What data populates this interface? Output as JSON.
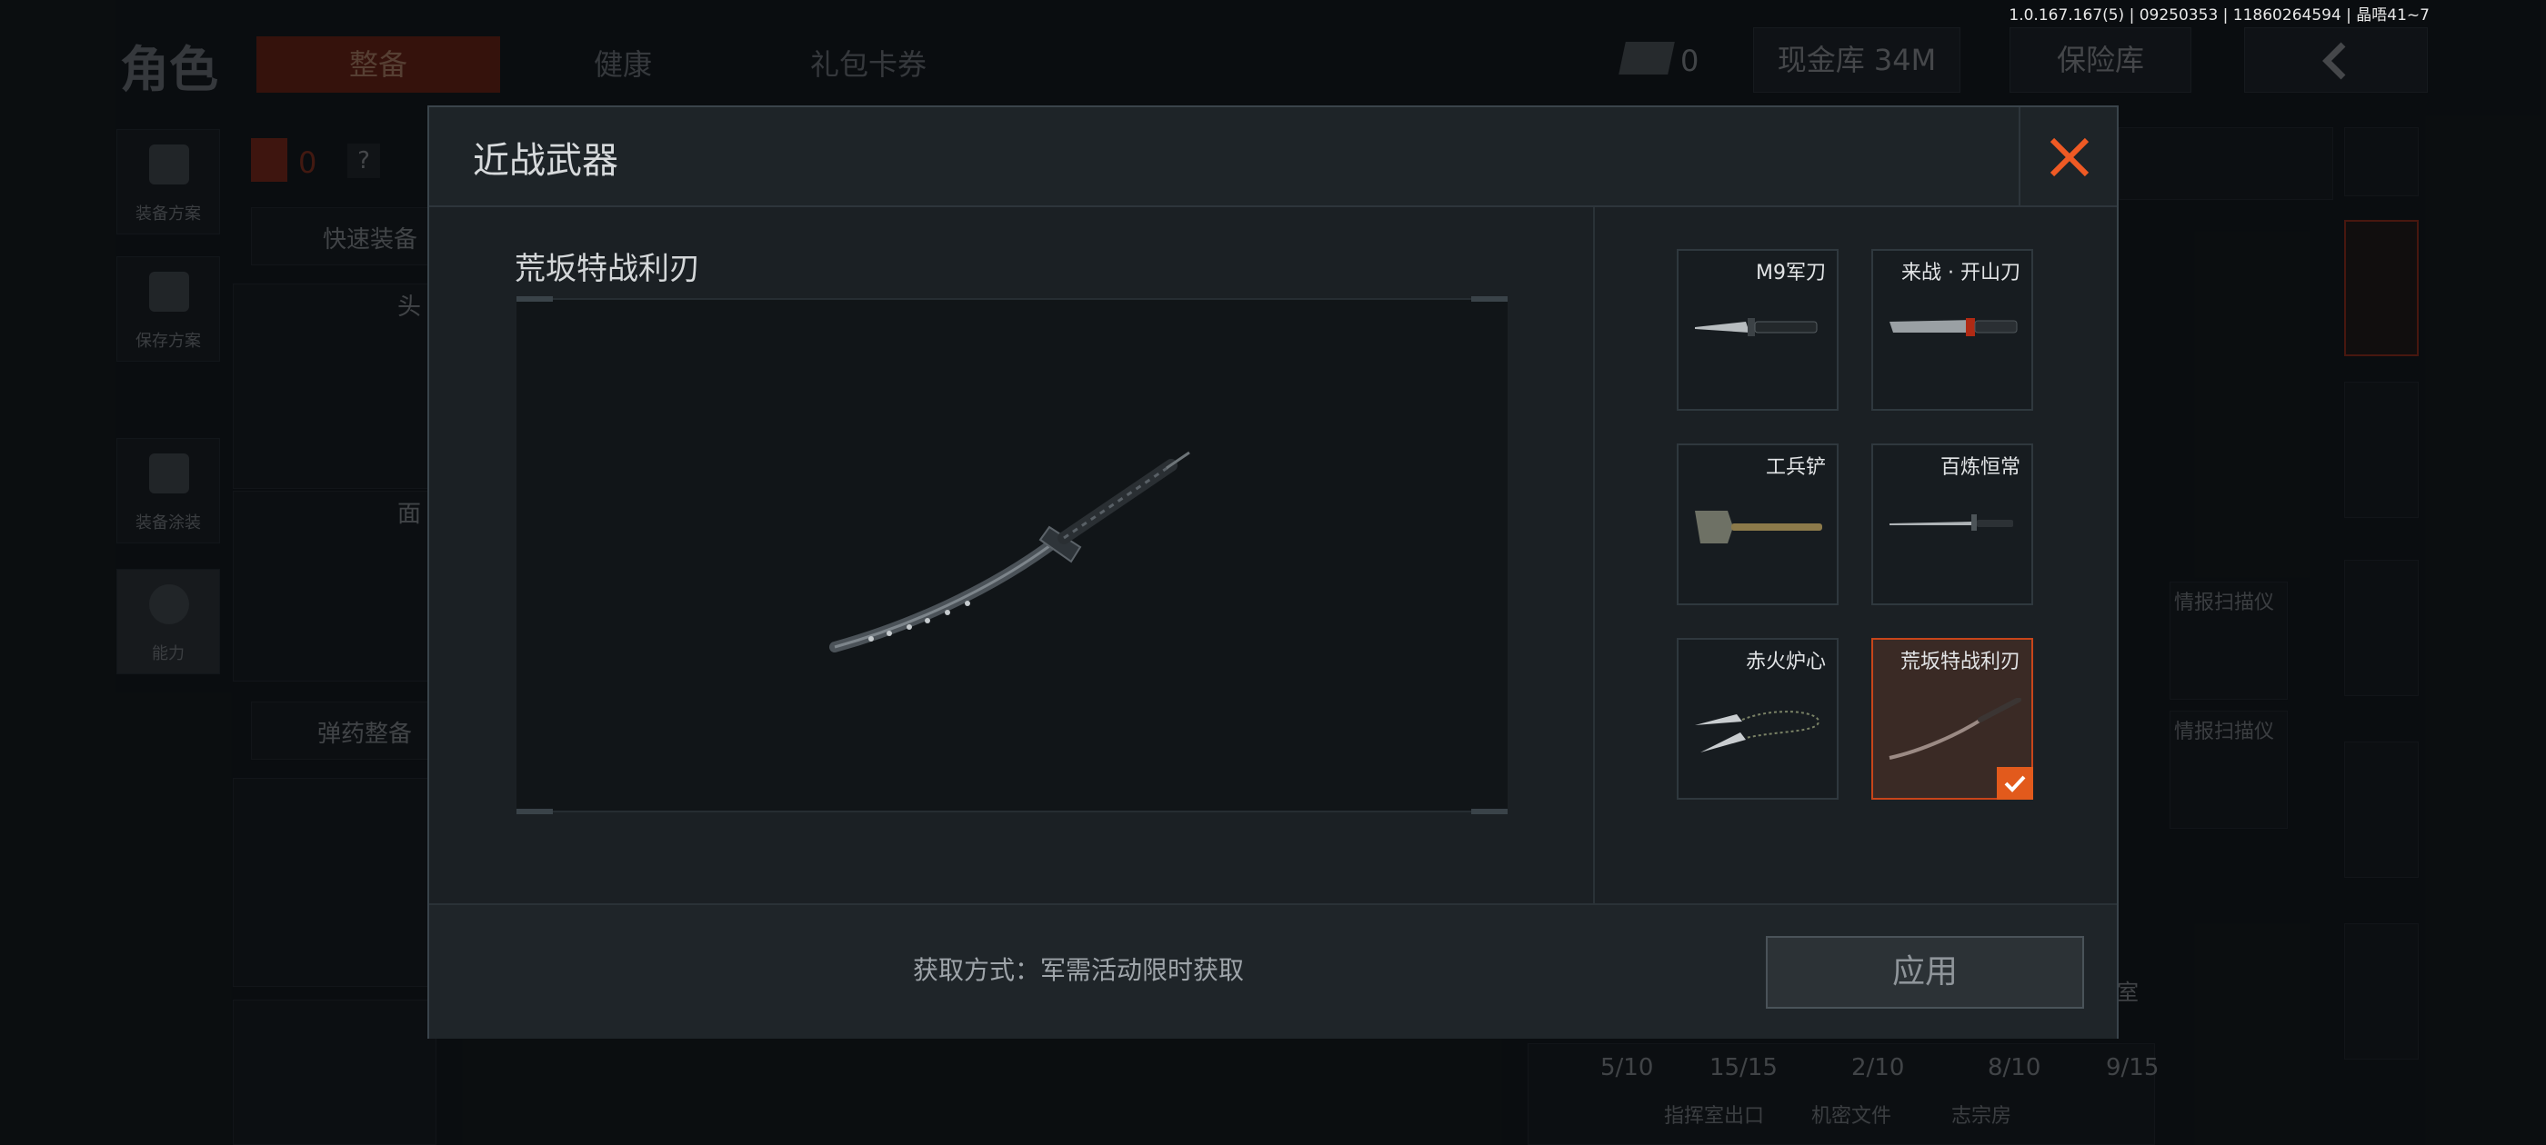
{
  "version_text": "1.0.167.167(5) | 09250353 | 11860264594 | 晶唔41~7",
  "background": {
    "page_title": "角色",
    "tabs": [
      {
        "label": "整备",
        "active": true
      },
      {
        "label": "健康",
        "active": false
      },
      {
        "label": "礼包卡券",
        "active": false
      }
    ],
    "ticket_count": "0",
    "cash_vault": "现金库 34M",
    "insurance": "保险库",
    "armor_count": "0",
    "help_mark": "?",
    "left_rail": [
      {
        "label": "装备方案",
        "icon": "vest-icon"
      },
      {
        "label": "保存方案",
        "icon": "download-icon"
      },
      {
        "label": "装备涂装",
        "icon": "helmet-icon"
      },
      {
        "label": "能力",
        "icon": "lightning-icon"
      }
    ],
    "quick_equip": "快速装备",
    "ammo_equip": "弹药整备",
    "slot_head": "头",
    "slot_face": "面",
    "intel_scanner_1": "情报扫描仪",
    "intel_scanner_2": "情报扫描仪",
    "inventory_counts": [
      "5/10",
      "15/15",
      "2/10",
      "8/10",
      "9/15"
    ],
    "bottom_labels": [
      "指挥室出口",
      "机密文件",
      "志宗房"
    ],
    "room_label": "室"
  },
  "modal": {
    "title": "近战武器",
    "close_icon": "close-x-icon",
    "preview_name": "荒坂特战利刃",
    "items": [
      {
        "name": "M9军刀",
        "art": "bayonet-icon",
        "selected": false
      },
      {
        "name": "来战 · 开山刀",
        "art": "machete-icon",
        "selected": false
      },
      {
        "name": "工兵铲",
        "art": "shovel-icon",
        "selected": false
      },
      {
        "name": "百炼恒常",
        "art": "sword-icon",
        "selected": false
      },
      {
        "name": "赤火炉心",
        "art": "twin-blades-icon",
        "selected": false
      },
      {
        "name": "荒坂特战利刃",
        "art": "katana-icon",
        "selected": true
      }
    ],
    "acquire_text": "获取方式：军需活动限时获取",
    "apply_label": "应用",
    "accent_color": "#e25a1c"
  }
}
